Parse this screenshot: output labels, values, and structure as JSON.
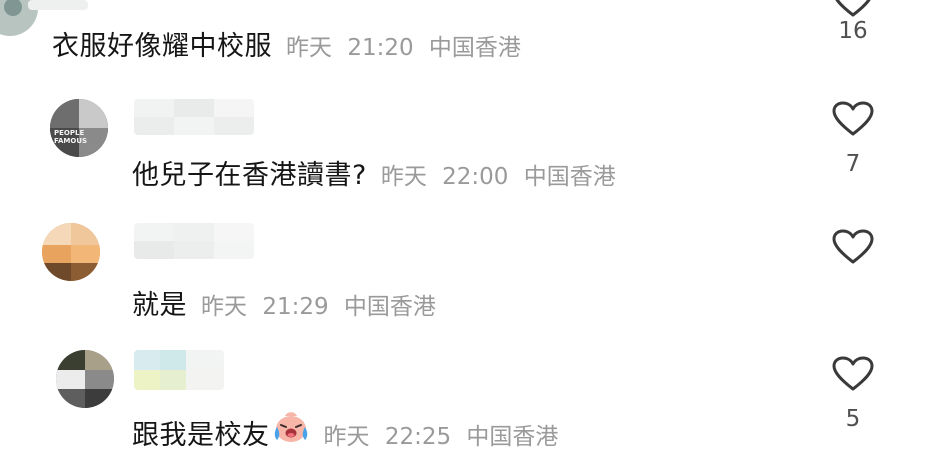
{
  "comments": [
    {
      "text": "衣服好像耀中校服",
      "date": "昨天",
      "time": "21:20",
      "location": "中国香港",
      "likes": "16"
    },
    {
      "text": "他兒子在香港讀書?",
      "date": "昨天",
      "time": "22:00",
      "location": "中国香港",
      "likes": "7",
      "avatar_text": "PEOPLE FAMOUS"
    },
    {
      "text": "就是",
      "date": "昨天",
      "time": "21:29",
      "location": "中国香港",
      "likes": ""
    },
    {
      "text": "跟我是校友",
      "emoji": "crying-laughing-emoji",
      "date": "昨天",
      "time": "22:25",
      "location": "中国香港",
      "likes": "5"
    }
  ],
  "icons": {
    "like": "heart-outline-icon"
  },
  "colors": {
    "text": "#161616",
    "meta": "#9a9a9a",
    "heart": "#3a3a3a"
  }
}
